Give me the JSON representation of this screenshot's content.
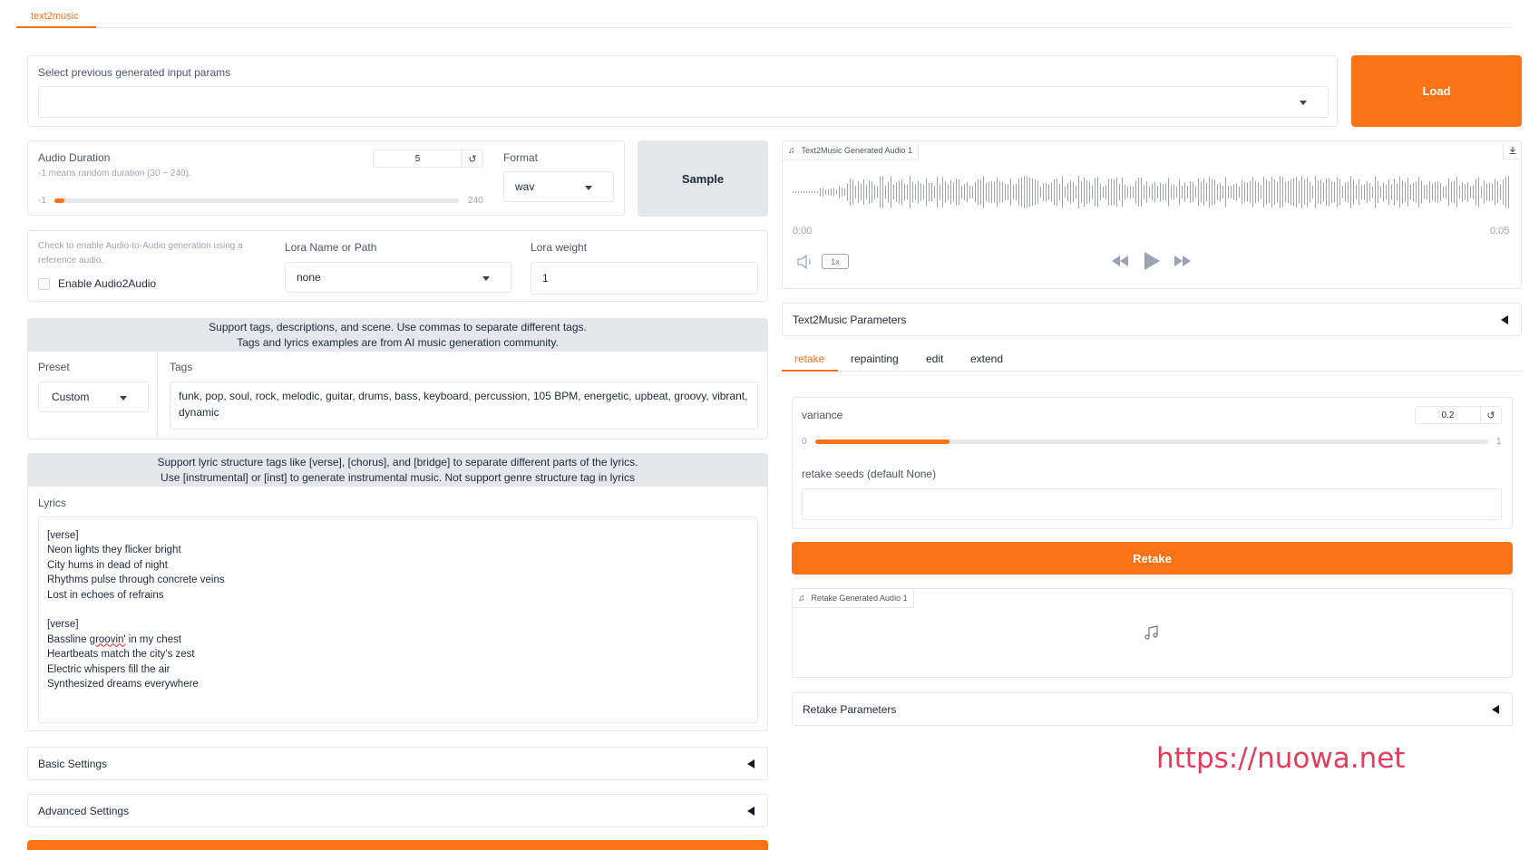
{
  "top_tab": "text2music",
  "previous_params": {
    "label": "Select previous generated input params",
    "value": "",
    "load_label": "Load"
  },
  "duration": {
    "label": "Audio Duration",
    "info": "-1 means random duration (30 ~ 240).",
    "value": "5",
    "min": "-1",
    "max": "240",
    "fraction": 0.025
  },
  "format": {
    "label": "Format",
    "value": "wav"
  },
  "sample_label": "Sample",
  "audio2audio": {
    "info": "Check to enable Audio-to-Audio generation using a reference audio.",
    "checkbox_label": "Enable Audio2Audio",
    "checked": false
  },
  "lora": {
    "name_label": "Lora Name or Path",
    "name_value": "none",
    "weight_label": "Lora weight",
    "weight_value": "1"
  },
  "tags_banner": {
    "line1": "Support tags, descriptions, and scene. Use commas to separate different tags.",
    "line2": "Tags and lyrics examples are from AI music generation community."
  },
  "preset": {
    "label": "Preset",
    "value": "Custom"
  },
  "tags": {
    "label": "Tags",
    "line1": "funk, pop, soul, rock, melodic, guitar, drums, bass, keyboard, percussion, 105 BPM, energetic, upbeat, groovy, vibrant,",
    "line2": "dynamic"
  },
  "lyrics_banner": {
    "line1": "Support lyric structure tags like [verse], [chorus], and [bridge] to separate different parts of the lyrics.",
    "line2": "Use [instrumental] or [inst] to generate instrumental music. Not support genre structure tag in lyrics"
  },
  "lyrics": {
    "label": "Lyrics",
    "l1": "[verse]",
    "l2": "Neon lights they flicker bright",
    "l3": "City hums in dead of night",
    "l4": "Rhythms pulse through concrete veins",
    "l5": "Lost in echoes of refrains",
    "l6": "[verse]",
    "l7a": "Bassline ",
    "l7b": "groovin'",
    "l7c": " in my chest",
    "l8": "Heartbeats match the city's zest",
    "l9": "Electric whispers fill the air",
    "l10": "Synthesized dreams everywhere"
  },
  "basic_settings": "Basic Settings",
  "advanced_settings": "Advanced Settings",
  "output_audio": {
    "tag": "Text2Music Generated Audio 1",
    "time_start": "0:00",
    "time_end": "0:05",
    "speed": "1x"
  },
  "t2m_params_label": "Text2Music Parameters",
  "mode_tabs": [
    "retake",
    "repainting",
    "edit",
    "extend"
  ],
  "active_mode": "retake",
  "variance": {
    "label": "variance",
    "value": "0.2",
    "min": "0",
    "max": "1",
    "fraction": 0.2
  },
  "retake_seeds": {
    "label": "retake seeds (default None)",
    "value": ""
  },
  "retake_label": "Retake",
  "retake_audio_tag": "Retake Generated Audio 1",
  "retake_params_label": "Retake Parameters",
  "watermark": "https://nuowa.net",
  "colors": {
    "accent": "#f97316",
    "grey_button": "#e5e7eb",
    "watermark": "#e23d5c"
  }
}
